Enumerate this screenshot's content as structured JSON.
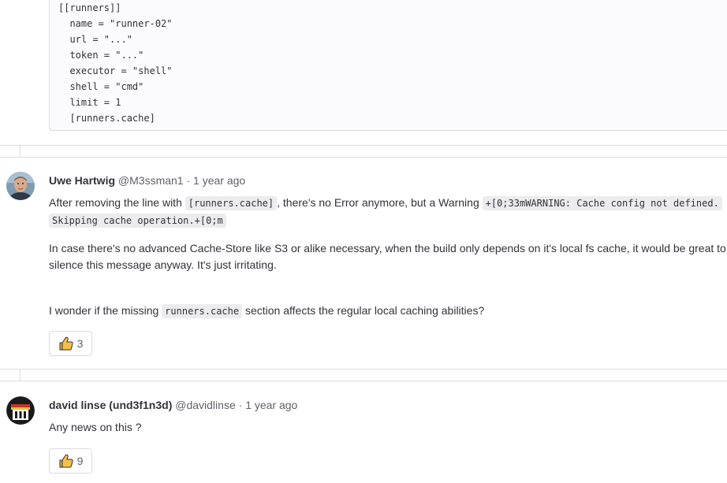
{
  "code_block": {
    "lines": [
      "[[runners]]",
      "  name = \"runner-02\"",
      "  url = \"...\"",
      "  token = \"...\"",
      "  executor = \"shell\"",
      "  shell = \"cmd\"",
      "  limit = 1",
      "  [runners.cache]"
    ]
  },
  "comments": [
    {
      "author": "Uwe Hartwig",
      "handle": "@M3ssman1",
      "separator": "·",
      "time": "1 year ago",
      "avatar_icon": "person-photo-avatar",
      "p1_before": "After removing the line with ",
      "p1_code1": "[runners.cache]",
      "p1_middle": ", there's no Error anymore, but a Warning ",
      "p1_code2a": "+[0;33mWARNING: Cache config not defined.",
      "p1_code2b": "Skipping cache operation.+[0;m",
      "p2": "In case there's no advanced Cache-Store like S3 or alike necessary, when the build only depends on it's local fs cache, it would be great to silence this message anyway. It's just irritating.",
      "p3_before": "I wonder if the missing ",
      "p3_code": "runners.cache",
      "p3_after": " section affects the regular local caching abilities?",
      "reaction_icon": "thumbs-up-icon",
      "reaction_count": "3"
    },
    {
      "author": "david linse (und3f1n3d)",
      "handle": "@davidlinse",
      "separator": "·",
      "time": "1 year ago",
      "avatar_icon": "pixel-art-avatar",
      "body": "Any news on this ?",
      "reaction_icon": "thumbs-up-icon",
      "reaction_count": "9"
    }
  ],
  "colors": {
    "reaction_thumb": "#e9a23b",
    "border": "#dcdcde",
    "code_bg": "#fbfafd",
    "inline_code_bg": "#ececef"
  }
}
